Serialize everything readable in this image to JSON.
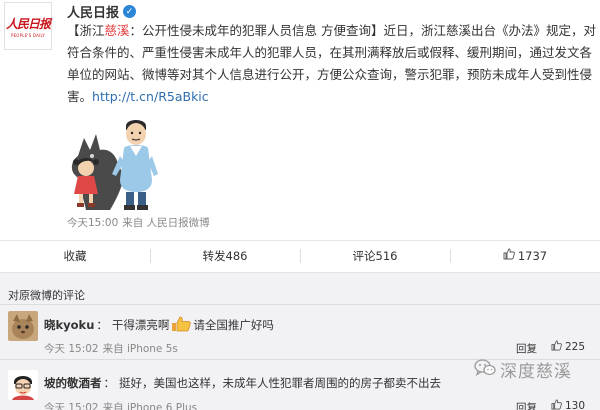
{
  "post": {
    "author": "人民日报",
    "logo_text_cn": "人民日报",
    "logo_text_en": "PEOPLE'S DAILY",
    "text": {
      "bracket_open": "【浙江",
      "highlight": "慈溪",
      "lead": "：公开性侵未成年的犯罪人员信息 方便查询】近日，浙江慈溪出台《办法》规定，对符合条件的、严重性侵害未成年人的犯罪人员，在其刑满释放后或假释、缓刑期间，通过发文各单位的网站、微博等对其个人信息进行公开，方便公众查询，警示犯罪，预防未成年人受到性侵害。",
      "link": "http://t.cn/R5aBkic"
    },
    "time": "今天15:00",
    "from": "来自 人民日报微博"
  },
  "actions": {
    "favorite": "收藏",
    "repost": "转发486",
    "comment": "评论516",
    "like": "1737"
  },
  "comments": {
    "header": "对原微博的评论",
    "items": [
      {
        "user": "晓kyoku",
        "text_before": "干得漂亮啊",
        "text_after": "请全国推广好吗",
        "time": "今天 15:02",
        "from": "来自 iPhone 5s",
        "reply": "回复",
        "likes": "225"
      },
      {
        "user": "坡的敬酒者",
        "text": "挺好，美国也这样，未成年人性犯罪者周围的的房子都卖不出去",
        "time": "今天 15:02",
        "from": "来自 iPhone 6 Plus",
        "reply": "回复",
        "likes": "130"
      }
    ]
  },
  "watermark": "深度慈溪",
  "colors": {
    "highlight": "#e4393c",
    "link": "#2e6eb0",
    "logo_red": "#c8161d",
    "comment_bg": "#f2f2f5",
    "meta_gray": "#888888"
  },
  "icons": [
    "verified-badge-icon",
    "like-icon",
    "thumbs-up-emoji-icon",
    "wechat-icon"
  ]
}
